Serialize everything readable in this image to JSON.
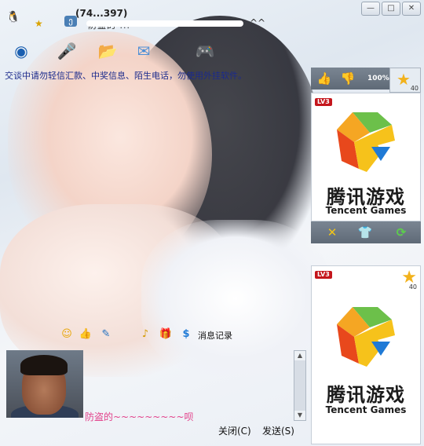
{
  "window": {
    "title": "(74...397)",
    "subtitle": "防盗的 ...",
    "expand_label": "^^",
    "buttons": [
      "—",
      "□",
      "✕"
    ]
  },
  "toolbar": {
    "icons": [
      "webcam-icon",
      "microphone-icon",
      "file-transfer-icon",
      "message-icon",
      "game-icon"
    ]
  },
  "warning": "交谈中请勿轻信汇款、中奖信息、陌生电话，勿使用外挂软件。",
  "right_panel": {
    "top_icons": [
      "thumbs-up-icon",
      "thumbs-down-icon",
      "percent-icon"
    ],
    "star_value": "40",
    "card1": {
      "level": "LV3",
      "brand_cn": "腾讯游戏",
      "brand_en": "Tencent Games"
    },
    "mid_icons": [
      "close-icon",
      "shirt-icon",
      "refresh-icon"
    ],
    "card2": {
      "level": "LV3",
      "brand_cn": "腾讯游戏",
      "brand_en": "Tencent Games",
      "star_value": "40"
    }
  },
  "format_bar": {
    "icons": [
      "emoji-icon",
      "thumb-icon",
      "edit-icon",
      "music-icon",
      "gift-icon",
      "money-icon"
    ],
    "history_label": "消息记录"
  },
  "input": {
    "text": "防盗的~~~~~~~~~呗"
  },
  "actions": {
    "close_label": "关闭(C)",
    "send_label": "发送(S)"
  }
}
